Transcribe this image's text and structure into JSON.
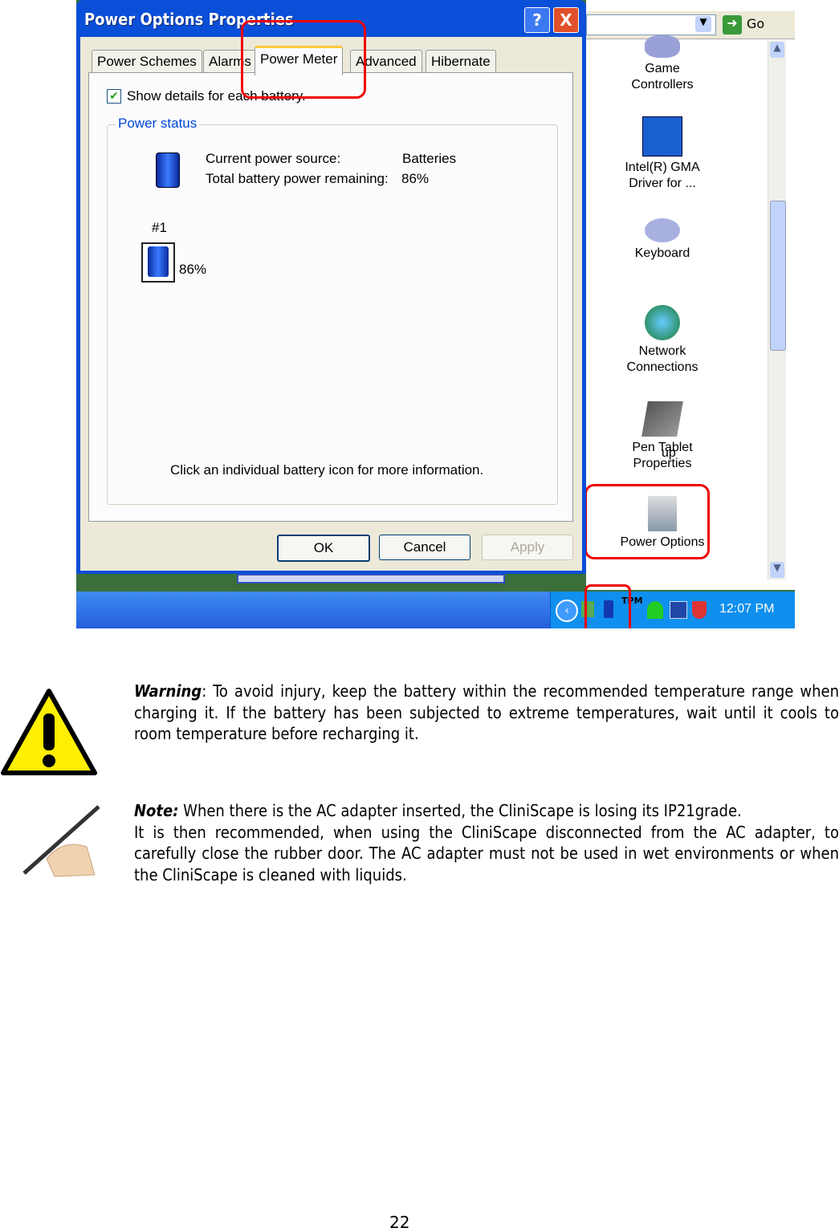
{
  "dialog": {
    "title": "Power Options Properties",
    "help_label": "?",
    "close_label": "X",
    "tabs": [
      {
        "label": "Power Schemes"
      },
      {
        "label": "Alarms"
      },
      {
        "label": "Power Meter"
      },
      {
        "label": "Advanced"
      },
      {
        "label": "Hibernate"
      }
    ],
    "show_details_label": "Show details for each battery.",
    "show_details_checked": true,
    "group_label": "Power status",
    "current_source_label": "Current power source:",
    "current_source_value": "Batteries",
    "remaining_label": "Total battery power remaining:",
    "remaining_value": "86%",
    "battery_id": "#1",
    "battery_percent": "86%",
    "hint": "Click an individual battery icon for more information.",
    "ok": "OK",
    "cancel": "Cancel",
    "apply": "Apply"
  },
  "explorer": {
    "go_label": "Go",
    "partial_text": "up",
    "items": [
      {
        "label1": "Game",
        "label2": "Controllers",
        "icon": "gamepad-icon"
      },
      {
        "label1": "Intel(R) GMA",
        "label2": "Driver for ...",
        "icon": "intel-gma-icon"
      },
      {
        "label1": "Keyboard",
        "label2": "",
        "icon": "keyboard-icon"
      },
      {
        "label1": "Network",
        "label2": "Connections",
        "icon": "network-icon"
      },
      {
        "label1": "Pen Tablet",
        "label2": "Properties",
        "icon": "pen-tablet-icon"
      },
      {
        "label1": "Power Options",
        "label2": "",
        "icon": "power-options-icon"
      }
    ]
  },
  "taskbar": {
    "clock": "12:07 PM",
    "tpm_label": "TPM"
  },
  "warning": {
    "label": "Warning",
    "text": ": To avoid injury, keep the battery within the recommended temperature range when charging it. If the battery has been subjected to extreme temperatures, wait until it cools to room temperature before recharging it."
  },
  "note": {
    "label": "Note:",
    "line1": " When there is the AC adapter inserted, the CliniScape is losing its IP21grade.",
    "text": "It is then recommended, when using the CliniScape disconnected from the AC adapter, to carefully close the rubber door. The AC adapter must not be used in wet environments or when the CliniScape is cleaned with liquids."
  },
  "page_number": "22",
  "colors": {
    "highlight": "#e00000",
    "xp_blue": "#0a4fd8",
    "group_label": "#0046d5"
  }
}
